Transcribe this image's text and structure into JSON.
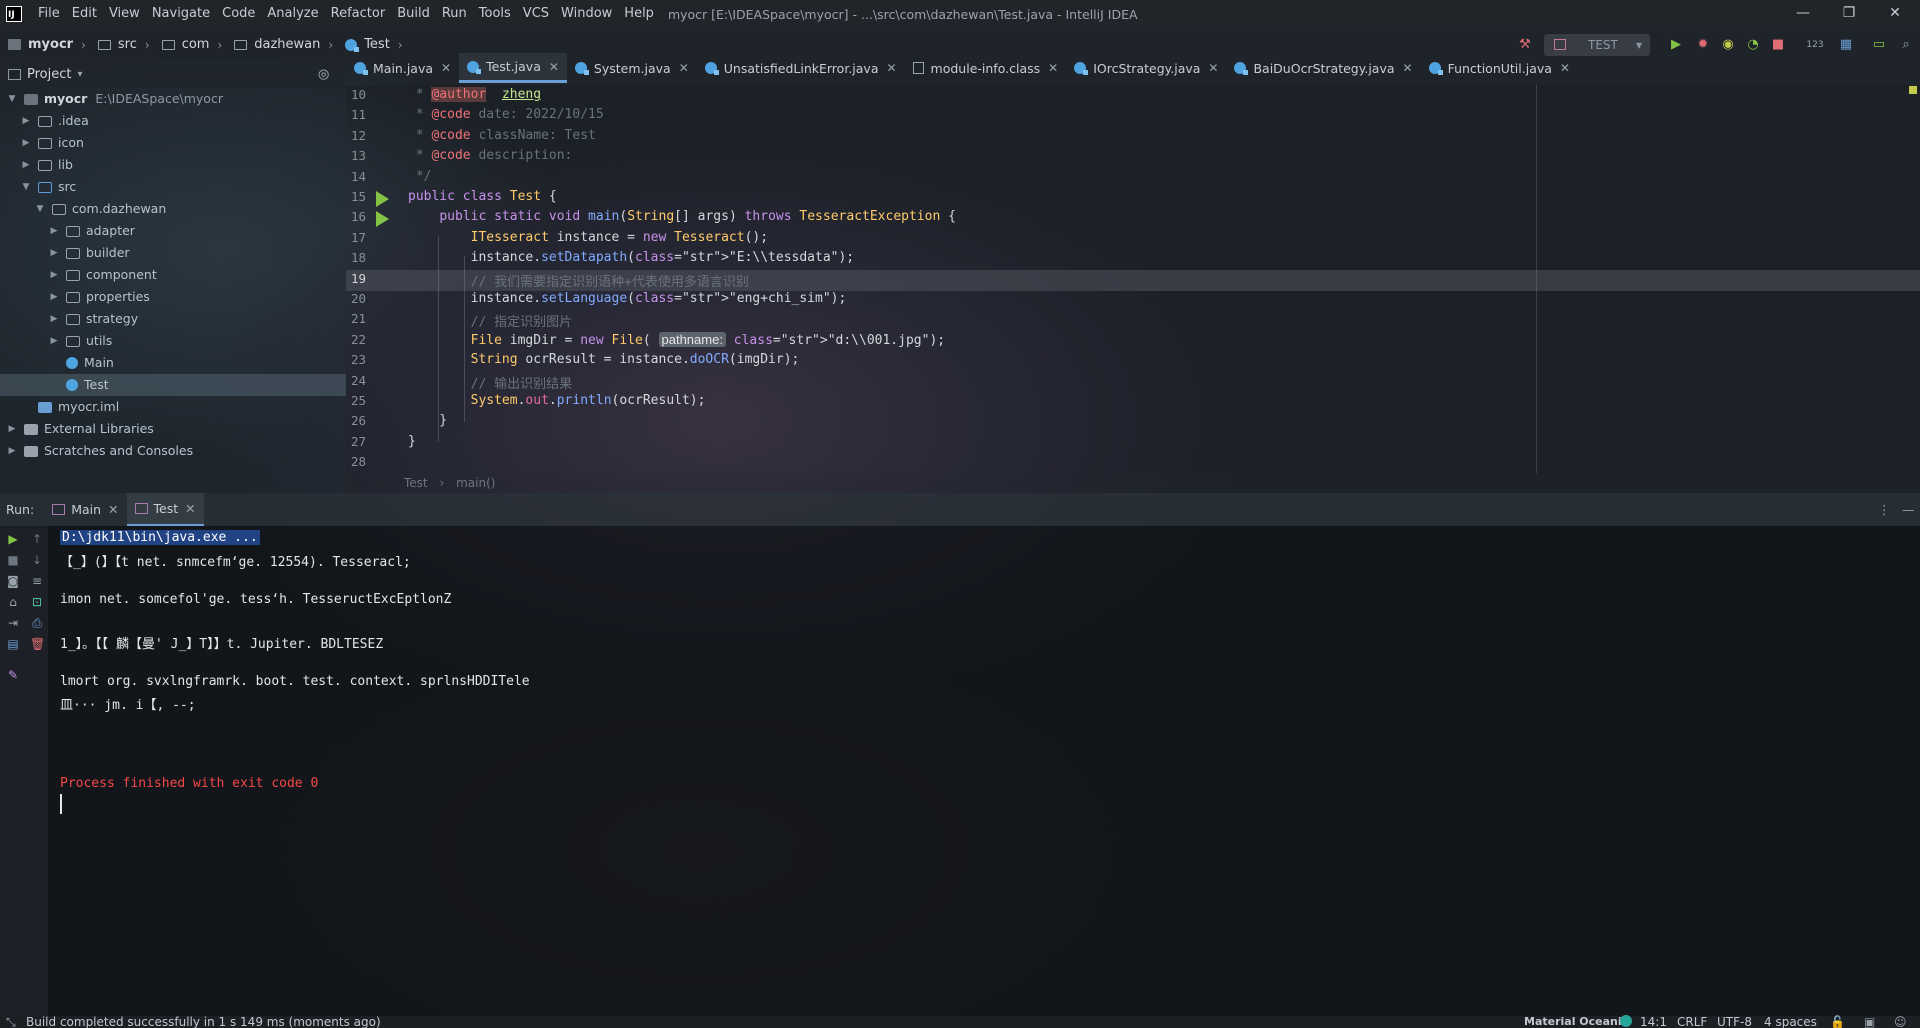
{
  "menubar": {
    "app_icon": "intellij-logo-icon",
    "items": [
      "File",
      "Edit",
      "View",
      "Navigate",
      "Code",
      "Analyze",
      "Refactor",
      "Build",
      "Run",
      "Tools",
      "VCS",
      "Window",
      "Help"
    ],
    "window_title": "myocr [E:\\IDEASpace\\myocr] - ...\\src\\com\\dazhewan\\Test.java - IntelliJ IDEA"
  },
  "breadcrumb": [
    "myocr",
    "src",
    "com",
    "dazhewan",
    "Test"
  ],
  "run_config": {
    "label": "TEST"
  },
  "toolbar_icons": [
    "build-hammer-icon",
    "run-icon",
    "debug-icon",
    "coverage-icon",
    "profile-icon",
    "stop-icon",
    "counter-icon",
    "project-structure-icon",
    "terminal-icon",
    "search-everywhere-icon"
  ],
  "project_panel": {
    "title": "Project",
    "tree": [
      {
        "label": "myocr",
        "path": "E:\\IDEASpace\\myocr",
        "depth": 0,
        "expanded": true,
        "kind": "project"
      },
      {
        "label": ".idea",
        "depth": 1,
        "expanded": false,
        "kind": "folder"
      },
      {
        "label": "icon",
        "depth": 1,
        "expanded": false,
        "kind": "folder"
      },
      {
        "label": "lib",
        "depth": 1,
        "expanded": false,
        "kind": "folder"
      },
      {
        "label": "src",
        "depth": 1,
        "expanded": true,
        "kind": "source"
      },
      {
        "label": "com.dazhewan",
        "depth": 2,
        "expanded": true,
        "kind": "package"
      },
      {
        "label": "adapter",
        "depth": 3,
        "expanded": false,
        "kind": "package"
      },
      {
        "label": "builder",
        "depth": 3,
        "expanded": false,
        "kind": "package"
      },
      {
        "label": "component",
        "depth": 3,
        "expanded": false,
        "kind": "package"
      },
      {
        "label": "properties",
        "depth": 3,
        "expanded": false,
        "kind": "package"
      },
      {
        "label": "strategy",
        "depth": 3,
        "expanded": false,
        "kind": "package"
      },
      {
        "label": "utils",
        "depth": 3,
        "expanded": false,
        "kind": "package"
      },
      {
        "label": "Main",
        "depth": 3,
        "kind": "class"
      },
      {
        "label": "Test",
        "depth": 3,
        "kind": "class",
        "selected": true
      },
      {
        "label": "myocr.iml",
        "depth": 1,
        "kind": "file"
      },
      {
        "label": "External Libraries",
        "depth": 0,
        "expanded": false,
        "kind": "library"
      },
      {
        "label": "Scratches and Consoles",
        "depth": 0,
        "expanded": false,
        "kind": "scratch"
      }
    ]
  },
  "editor_tabs": [
    {
      "label": "Main.java"
    },
    {
      "label": "Test.java",
      "active": true
    },
    {
      "label": "System.java"
    },
    {
      "label": "UnsatisfiedLinkError.java"
    },
    {
      "label": "module-info.class"
    },
    {
      "label": "IOrcStrategy.java"
    },
    {
      "label": "BaiDuOcrStrategy.java"
    },
    {
      "label": "FunctionUtil.java"
    }
  ],
  "editor": {
    "current_line": 19,
    "lines": [
      {
        "n": "10",
        "t": " * @author  zheng"
      },
      {
        "n": "11",
        "t": " * @code date: 2022/10/15"
      },
      {
        "n": "12",
        "t": " * @code className: Test"
      },
      {
        "n": "13",
        "t": " * @code description:"
      },
      {
        "n": "14",
        "t": " */"
      },
      {
        "n": "15",
        "t": "public class Test {"
      },
      {
        "n": "16",
        "t": "    public static void main(String[] args) throws TesseractException {"
      },
      {
        "n": "17",
        "t": "        ITesseract instance = new Tesseract();"
      },
      {
        "n": "18",
        "t": "        instance.setDatapath(\"E:\\\\tessdata\");"
      },
      {
        "n": "19",
        "t": "        // 我们需要指定识别语种+代表使用多语言识别"
      },
      {
        "n": "20",
        "t": "        instance.setLanguage(\"eng+chi_sim\");"
      },
      {
        "n": "21",
        "t": "        // 指定识别图片"
      },
      {
        "n": "22",
        "t": "        File imgDir = new File( pathname: \"d:\\\\001.jpg\");"
      },
      {
        "n": "23",
        "t": "        String ocrResult = instance.doOCR(imgDir);"
      },
      {
        "n": "24",
        "t": "        // 输出识别结果"
      },
      {
        "n": "25",
        "t": "        System.out.println(ocrResult);"
      },
      {
        "n": "26",
        "t": "    }"
      },
      {
        "n": "27",
        "t": "}"
      },
      {
        "n": "28",
        "t": ""
      }
    ],
    "param_hint": "pathname:",
    "breadcrumb": [
      "Test",
      "main()"
    ]
  },
  "run_panel": {
    "label": "Run:",
    "tabs": [
      {
        "label": "Main"
      },
      {
        "label": "Test",
        "active": true
      }
    ],
    "console": [
      {
        "t": "D:\\jdk11\\bin\\java.exe ...",
        "selected": true
      },
      {
        "t": "【_】(】【t net. snmcefm‘ge. 12554). Tesseracl;"
      },
      {
        "t": ""
      },
      {
        "t": "imon net. somcefol'ge. tess‘h. TesseructExcEptlonZ"
      },
      {
        "t": ""
      },
      {
        "t": "1_】。【【 麟【曼' J_】T】】t. Jupiter. BDLTESEZ"
      },
      {
        "t": ""
      },
      {
        "t": "lmort org. svxlngframrk. boot. test. context. sprlnsHDDITele"
      },
      {
        "t": "皿··· jm. i【, --;"
      },
      {
        "t": ""
      },
      {
        "t": ""
      },
      {
        "t": ""
      },
      {
        "t": "Process finished with exit code 0",
        "error": true
      }
    ]
  },
  "status_bar": {
    "message": "Build completed successfully in 1 s 149 ms (moments ago)",
    "theme": "Material Oceanic",
    "position": "14:1",
    "line_sep": "CRLF",
    "encoding": "UTF-8",
    "indent": "4 spaces"
  }
}
